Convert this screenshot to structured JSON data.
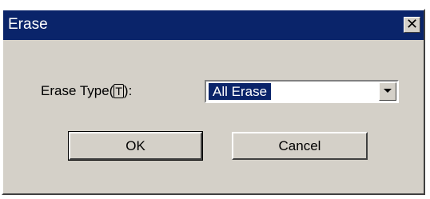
{
  "window": {
    "title": "Erase",
    "close_symbol": "✕"
  },
  "form": {
    "erase_type_label": "Erase Type(",
    "erase_type_mnemonic": "T",
    "erase_type_label_suffix": "):",
    "erase_type_value": "All Erase"
  },
  "buttons": {
    "ok_label": "OK",
    "cancel_label": "Cancel"
  },
  "icons": {
    "close": "close-icon",
    "dropdown": "chevron-down-icon"
  },
  "colors": {
    "titlebar": "#0a246a",
    "dialog_face": "#d4d0c8",
    "selection": "#0a246a"
  }
}
